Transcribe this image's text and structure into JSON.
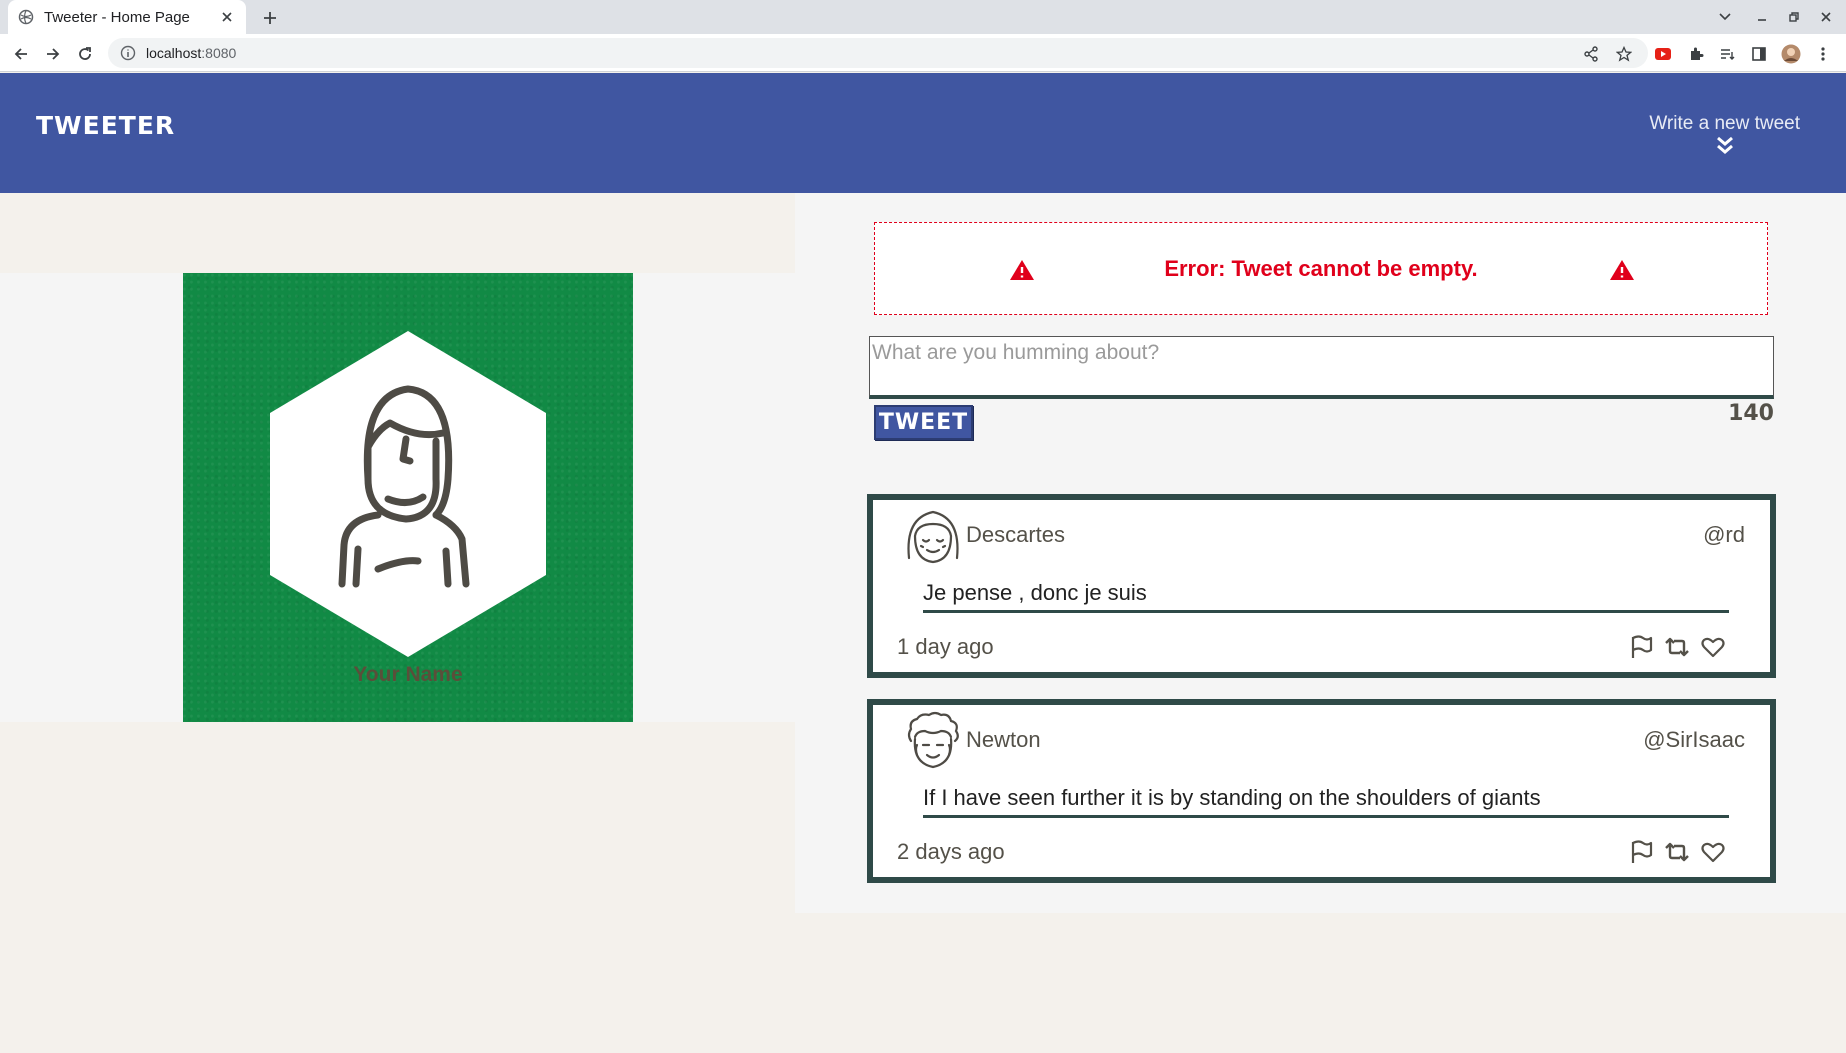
{
  "browser": {
    "tab_title": "Tweeter - Home Page",
    "url_host": "localhost",
    "url_port": ":8080"
  },
  "header": {
    "brand": "TWEETER",
    "compose_toggle_label": "Write a new tweet"
  },
  "profile": {
    "name": "Your Name"
  },
  "compose": {
    "error": "Error: Tweet cannot be empty.",
    "placeholder": "What are you humming about?",
    "submit_label": "TWEET",
    "counter": "140"
  },
  "tweets": [
    {
      "author": "Descartes",
      "handle": "@rd",
      "text": "Je pense , donc je suis",
      "time": "1 day ago"
    },
    {
      "author": "Newton",
      "handle": "@SirIsaac",
      "text": "If I have seen further it is by standing on the shoulders of giants",
      "time": "2 days ago"
    }
  ],
  "colors": {
    "header_bg": "#4056a1",
    "error_red": "#e0001b",
    "card_border": "#2f4a48",
    "profile_green": "#118a45"
  }
}
